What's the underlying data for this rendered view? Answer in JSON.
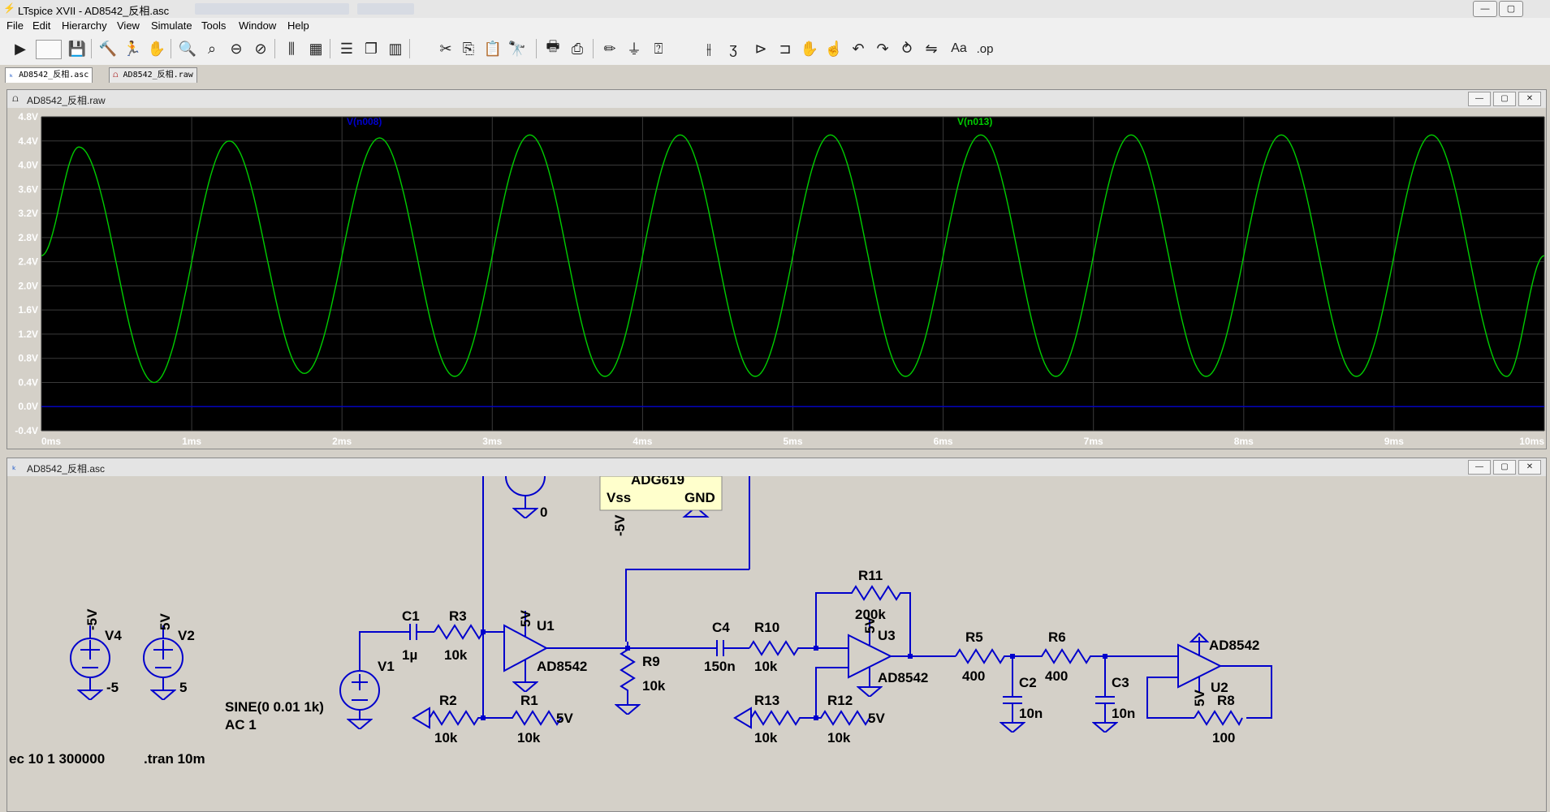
{
  "window": {
    "title": "LTspice XVII - AD8542_反相.asc",
    "icon": "ltspice-app-icon"
  },
  "menu": [
    "File",
    "Edit",
    "Hierarchy",
    "View",
    "Simulate",
    "Tools",
    "Window",
    "Help"
  ],
  "toolbar": {
    "icons": [
      "run-icon",
      "halt-icon",
      "save-icon",
      "control-panel-icon",
      "run-sim-icon",
      "pan-icon",
      "zoom-in-icon",
      "zoom-area-icon",
      "zoom-out-icon",
      "zoom-cancel-icon",
      "autorange-icon",
      "clear-icon",
      "tile-horizontal-icon",
      "cascade-icon",
      "tile-vertical-icon",
      "cut-icon",
      "copy-icon",
      "paste-icon",
      "find-icon",
      "print-icon",
      "print-preview-icon",
      "pencil-icon",
      "ground-icon",
      "label-icon",
      "capacitor-icon",
      "inductor-icon",
      "diode-icon",
      "component-icon",
      "move-icon",
      "drag-icon",
      "undo-icon",
      "redo-icon",
      "rotate-icon",
      "mirror-icon",
      "text-icon",
      "spice-directive-icon"
    ]
  },
  "tabs": [
    {
      "label": "AD8542_反相.asc",
      "active": true
    },
    {
      "label": "AD8542_反相.raw",
      "active": false
    }
  ],
  "waveform": {
    "window_title": "AD8542_反相.raw",
    "trace_labels": [
      {
        "label": "V(n008)",
        "color": "#0000cc"
      },
      {
        "label": "V(n013)",
        "color": "#00cc00"
      }
    ],
    "colors": {
      "background": "#000000",
      "grid": "#3a3a3a",
      "axis_text": "#ffffff"
    }
  },
  "chart_data": {
    "type": "line",
    "x_label": "",
    "y_label": "",
    "xlim": [
      0,
      10
    ],
    "ylim": [
      -0.4,
      4.8
    ],
    "x_ticks": [
      "0ms",
      "1ms",
      "2ms",
      "3ms",
      "4ms",
      "5ms",
      "6ms",
      "7ms",
      "8ms",
      "9ms",
      "10ms"
    ],
    "y_ticks": [
      "4.8V",
      "4.4V",
      "4.0V",
      "3.6V",
      "3.2V",
      "2.8V",
      "2.4V",
      "2.0V",
      "1.6V",
      "1.2V",
      "0.8V",
      "0.4V",
      "0.0V",
      "-0.4V"
    ],
    "series": [
      {
        "name": "V(n008)",
        "color": "#0000cc",
        "x": [
          0,
          10
        ],
        "y": [
          0.0,
          0.0
        ]
      },
      {
        "name": "V(n013)",
        "color": "#00cc00",
        "frequency_khz": 1,
        "offset_v": 2.5,
        "amplitude_v": 2.0,
        "x": [
          0,
          0.25,
          0.75,
          1.25,
          1.75,
          2.25,
          2.75,
          3.25,
          3.75,
          4.25,
          4.75,
          5.25,
          5.75,
          6.25,
          6.75,
          7.25,
          7.75,
          8.25,
          8.75,
          9.25,
          9.75,
          10
        ],
        "y": [
          2.5,
          4.3,
          0.4,
          4.4,
          0.55,
          4.45,
          0.5,
          4.5,
          0.5,
          4.5,
          0.5,
          4.5,
          0.5,
          4.5,
          0.5,
          4.5,
          0.5,
          4.5,
          0.5,
          4.5,
          0.5,
          2.5
        ]
      }
    ]
  },
  "schematic": {
    "window_title": "AD8542_反相.asc",
    "labels": {
      "adg_name": "ADG619",
      "vss": "Vss",
      "gnd": "GND",
      "neg5": "-5V",
      "zero": "0",
      "v4": "V4",
      "v4_pin": "-5V",
      "v4_val": "-5",
      "v2": "V2",
      "v2_pin": "5V",
      "v2_val": "5",
      "c1": "C1",
      "c1_val": "1µ",
      "r3": "R3",
      "r3_val": "10k",
      "u1": "U1",
      "u1_pin": "5V",
      "u1_model": "AD8542",
      "v1": "V1",
      "sine": "SINE(0 0.01 1k)",
      "ac": "AC 1",
      "r2": "R2",
      "r2_val": "10k",
      "r1": "R1",
      "r1_val": "10k",
      "r1_rail": "5V",
      "r9": "R9",
      "r9_val": "10k",
      "c4": "C4",
      "c4_val": "150n",
      "r10": "R10",
      "r10_val": "10k",
      "r11": "R11",
      "r11_val": "200k",
      "u3": "U3",
      "u3_pin": "5V",
      "u3_model": "AD8542",
      "r13": "R13",
      "r13_val": "10k",
      "r12": "R12",
      "r12_val": "10k",
      "r12_rail": "5V",
      "r5": "R5",
      "r5_val": "400",
      "r6": "R6",
      "r6_val": "400",
      "c2": "C2",
      "c2_val": "10n",
      "c3": "C3",
      "c3_val": "10n",
      "u2_model": "AD8542",
      "u2": "U2",
      "u2_pin": "5V",
      "r8": "R8",
      "r8_val": "100",
      "directive_ac": "ec 10 1 300000",
      "directive_tran": ".tran 10m"
    }
  }
}
